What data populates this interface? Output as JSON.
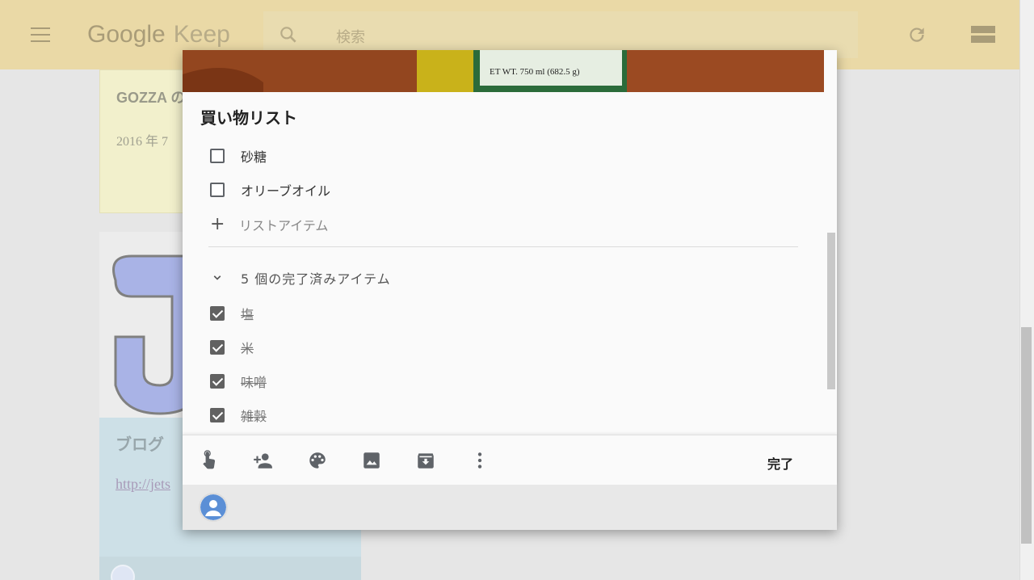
{
  "app": {
    "logo_google": "Google",
    "logo_keep": "Keep",
    "search_placeholder": "検索"
  },
  "background_notes": {
    "yellow_title": "GOZZA の",
    "yellow_date": "2016 年 7",
    "blue_title": "ブログ",
    "blue_link": "http://jets"
  },
  "modal": {
    "image_caption": "ET WT. 750 ml (682.5 g)",
    "title": "買い物リスト",
    "items": [
      {
        "label": "砂糖",
        "checked": false
      },
      {
        "label": "オリーブオイル",
        "checked": false
      }
    ],
    "add_item_placeholder": "リストアイテム",
    "completed_header": "5 個の完了済みアイテム",
    "completed": [
      {
        "label": "塩",
        "checked": true
      },
      {
        "label": "米",
        "checked": true
      },
      {
        "label": "味噌",
        "checked": true
      },
      {
        "label": "雑穀",
        "checked": true
      }
    ],
    "done_label": "完了"
  },
  "toolbar_icons": [
    "reminder-icon",
    "collaborator-icon",
    "palette-icon",
    "image-icon",
    "archive-icon",
    "more-icon"
  ],
  "colors": {
    "header": "#ead9a6",
    "yellow_note": "#f2f0cc",
    "blue_note": "#cde0e7"
  }
}
